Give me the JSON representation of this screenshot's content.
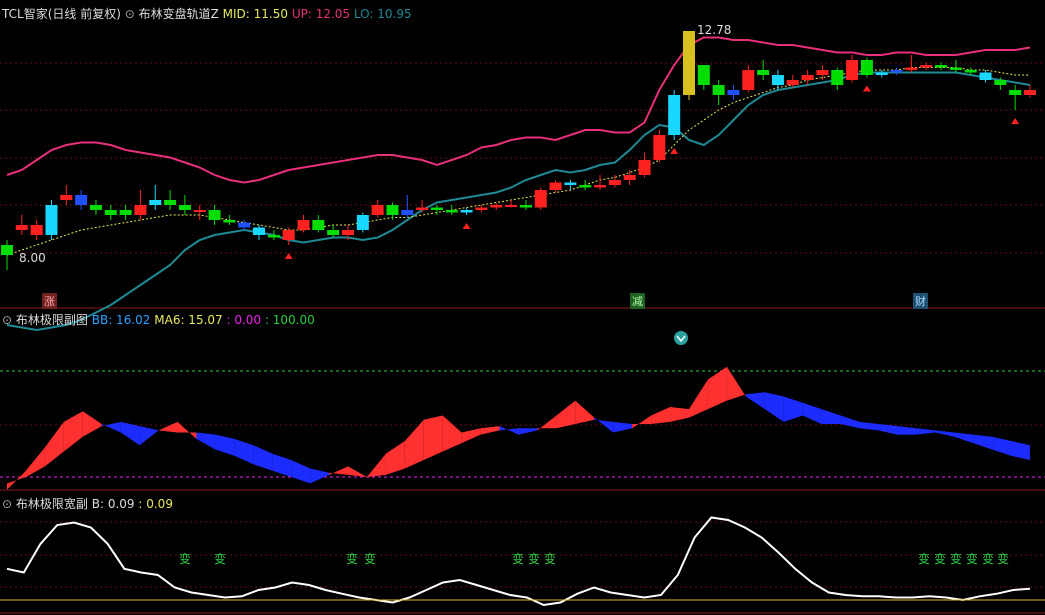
{
  "header_main": {
    "stock": "TCL智家(日线 前复权)",
    "indicator": "布林变盘轨道Z",
    "mid_label": "MID: 11.50",
    "up_label": "UP: 12.05",
    "lo_label": "LO: 10.95"
  },
  "header_sub1": {
    "indicator": "布林极限副图",
    "bb_label": "BB: 16.02",
    "ma6_label": "MA6: 15.07",
    "v1_label": ": 0.00",
    "v2_label": ": 100.00"
  },
  "header_sub2": {
    "indicator": "布林极限宽副",
    "b_label": "B: 0.09",
    "v_label": ": 0.09"
  },
  "price_labels": {
    "high": "12.78",
    "low": "8.00"
  },
  "event_labels": {
    "zhang": "涨",
    "jian": "减",
    "cai": "财"
  },
  "bian_label": "变",
  "colors": {
    "up_band": "#e8307a",
    "lo_band": "#1e8a96",
    "mid": "#e8e85a",
    "bull": "#ff2020",
    "bear": "#00dd00",
    "blue": "#2050ff",
    "cyan": "#1ad7ff",
    "yellow": "#d8c020",
    "magenta": "#ee22ee",
    "white": "#ffffff"
  },
  "chart_data": [
    {
      "type": "candlestick",
      "title": "布林变盘轨道Z",
      "annotations": [
        "12.78",
        "8.00"
      ],
      "candles": [
        [
          8.5,
          8.3,
          8.6,
          8.0
        ],
        [
          8.8,
          8.9,
          9.1,
          8.7
        ],
        [
          8.7,
          8.9,
          9.0,
          8.6
        ],
        [
          8.7,
          9.3,
          9.4,
          8.6
        ],
        [
          9.4,
          9.5,
          9.7,
          9.3
        ],
        [
          9.5,
          9.3,
          9.6,
          9.2
        ],
        [
          9.3,
          9.2,
          9.4,
          9.1
        ],
        [
          9.2,
          9.1,
          9.3,
          9.0
        ],
        [
          9.2,
          9.1,
          9.3,
          9.0
        ],
        [
          9.1,
          9.3,
          9.6,
          9.0
        ],
        [
          9.3,
          9.4,
          9.7,
          9.2
        ],
        [
          9.4,
          9.3,
          9.6,
          9.2
        ],
        [
          9.3,
          9.2,
          9.5,
          9.1
        ],
        [
          9.2,
          9.2,
          9.3,
          9.0
        ],
        [
          9.2,
          9.0,
          9.3,
          8.9
        ],
        [
          9.0,
          8.95,
          9.1,
          8.9
        ],
        [
          8.95,
          8.85,
          9.0,
          8.8
        ],
        [
          8.85,
          8.7,
          8.9,
          8.6
        ],
        [
          8.7,
          8.65,
          8.8,
          8.6
        ],
        [
          8.6,
          8.8,
          8.85,
          8.5
        ],
        [
          8.8,
          9.0,
          9.1,
          8.75
        ],
        [
          9.0,
          8.8,
          9.1,
          8.75
        ],
        [
          8.8,
          8.7,
          8.9,
          8.65
        ],
        [
          8.7,
          8.8,
          8.9,
          8.6
        ],
        [
          8.8,
          9.1,
          9.15,
          8.75
        ],
        [
          9.1,
          9.3,
          9.4,
          9.05
        ],
        [
          9.3,
          9.1,
          9.35,
          9.0
        ],
        [
          9.1,
          9.2,
          9.5,
          9.05
        ],
        [
          9.2,
          9.25,
          9.4,
          9.15
        ],
        [
          9.25,
          9.2,
          9.3,
          9.1
        ],
        [
          9.2,
          9.15,
          9.3,
          9.1
        ],
        [
          9.15,
          9.2,
          9.25,
          9.1
        ],
        [
          9.2,
          9.25,
          9.3,
          9.15
        ],
        [
          9.25,
          9.3,
          9.35,
          9.2
        ],
        [
          9.3,
          9.3,
          9.4,
          9.25
        ],
        [
          9.3,
          9.25,
          9.4,
          9.2
        ],
        [
          9.25,
          9.6,
          9.65,
          9.2
        ],
        [
          9.6,
          9.75,
          9.8,
          9.55
        ],
        [
          9.75,
          9.7,
          9.8,
          9.6
        ],
        [
          9.7,
          9.65,
          9.8,
          9.6
        ],
        [
          9.65,
          9.7,
          9.9,
          9.6
        ],
        [
          9.7,
          9.8,
          9.9,
          9.65
        ],
        [
          9.8,
          9.9,
          10.0,
          9.7
        ],
        [
          9.9,
          10.2,
          10.35,
          9.85
        ],
        [
          10.2,
          10.7,
          10.8,
          10.15
        ],
        [
          10.7,
          11.5,
          11.6,
          10.6
        ],
        [
          11.5,
          12.78,
          12.78,
          11.4
        ],
        [
          12.1,
          11.7,
          12.1,
          11.6
        ],
        [
          11.7,
          11.5,
          11.8,
          11.3
        ],
        [
          11.5,
          11.6,
          11.7,
          11.4
        ],
        [
          11.6,
          12.0,
          12.1,
          11.55
        ],
        [
          12.0,
          11.9,
          12.2,
          11.8
        ],
        [
          11.9,
          11.7,
          12.0,
          11.6
        ],
        [
          11.7,
          11.8,
          11.9,
          11.65
        ],
        [
          11.8,
          11.9,
          12.0,
          11.7
        ],
        [
          11.9,
          12.0,
          12.1,
          11.8
        ],
        [
          12.0,
          11.7,
          12.05,
          11.6
        ],
        [
          11.8,
          12.2,
          12.3,
          11.75
        ],
        [
          12.2,
          11.9,
          12.25,
          11.85
        ],
        [
          11.9,
          11.95,
          12.0,
          11.85
        ],
        [
          11.95,
          12.0,
          12.05,
          11.9
        ],
        [
          12.0,
          12.05,
          12.3,
          11.95
        ],
        [
          12.05,
          12.1,
          12.15,
          12.0
        ],
        [
          12.1,
          12.05,
          12.15,
          12.0
        ],
        [
          12.05,
          12.0,
          12.2,
          11.95
        ],
        [
          12.0,
          11.95,
          12.05,
          11.9
        ],
        [
          11.95,
          11.8,
          12.0,
          11.75
        ],
        [
          11.8,
          11.7,
          11.85,
          11.6
        ],
        [
          11.6,
          11.5,
          11.7,
          11.2
        ],
        [
          11.5,
          11.6,
          11.7,
          11.45
        ]
      ],
      "up_band": [
        9.9,
        10.0,
        10.2,
        10.4,
        10.5,
        10.55,
        10.55,
        10.5,
        10.4,
        10.35,
        10.3,
        10.25,
        10.15,
        10.05,
        9.9,
        9.8,
        9.75,
        9.8,
        9.9,
        10.0,
        10.05,
        10.1,
        10.15,
        10.2,
        10.25,
        10.3,
        10.3,
        10.25,
        10.2,
        10.1,
        10.2,
        10.3,
        10.45,
        10.5,
        10.6,
        10.65,
        10.65,
        10.6,
        10.7,
        10.8,
        10.8,
        10.75,
        10.75,
        10.95,
        11.6,
        12.1,
        12.5,
        12.65,
        12.65,
        12.6,
        12.6,
        12.55,
        12.5,
        12.5,
        12.45,
        12.4,
        12.35,
        12.35,
        12.3,
        12.3,
        12.35,
        12.35,
        12.3,
        12.3,
        12.3,
        12.35,
        12.4,
        12.4,
        12.4,
        12.45
      ],
      "mid_band": [
        8.3,
        8.4,
        8.5,
        8.6,
        8.7,
        8.8,
        8.85,
        8.9,
        8.95,
        9.0,
        9.05,
        9.1,
        9.1,
        9.1,
        9.05,
        9.0,
        8.95,
        8.9,
        8.85,
        8.8,
        8.8,
        8.85,
        8.9,
        8.9,
        8.95,
        9.0,
        9.05,
        9.05,
        9.1,
        9.15,
        9.2,
        9.25,
        9.3,
        9.35,
        9.4,
        9.45,
        9.5,
        9.55,
        9.6,
        9.7,
        9.8,
        9.85,
        9.95,
        10.05,
        10.2,
        10.5,
        10.8,
        11.0,
        11.2,
        11.35,
        11.45,
        11.55,
        11.65,
        11.7,
        11.8,
        11.85,
        11.9,
        11.95,
        12.0,
        12.0,
        12.0,
        12.05,
        12.05,
        12.05,
        12.05,
        12.0,
        12.0,
        11.95,
        11.9,
        11.9
      ],
      "lo_band": [
        6.9,
        6.85,
        6.8,
        6.85,
        6.9,
        7.0,
        7.15,
        7.3,
        7.5,
        7.7,
        7.9,
        8.1,
        8.4,
        8.6,
        8.7,
        8.75,
        8.8,
        8.75,
        8.7,
        8.6,
        8.55,
        8.6,
        8.65,
        8.65,
        8.6,
        8.65,
        8.8,
        9.0,
        9.2,
        9.35,
        9.4,
        9.45,
        9.5,
        9.55,
        9.65,
        9.8,
        9.9,
        10.0,
        9.95,
        10.0,
        10.1,
        10.15,
        10.4,
        10.7,
        10.9,
        10.85,
        10.6,
        10.5,
        10.7,
        11.0,
        11.3,
        11.5,
        11.6,
        11.65,
        11.7,
        11.75,
        11.8,
        11.9,
        11.95,
        11.95,
        11.95,
        11.95,
        11.95,
        11.95,
        11.95,
        11.9,
        11.85,
        11.8,
        11.75,
        11.7
      ]
    },
    {
      "type": "area",
      "title": "布林极限副图",
      "series": [
        {
          "name": "BB",
          "values": [
            -12,
            6,
            28,
            52,
            62,
            50,
            42,
            30,
            44,
            52,
            36,
            26,
            20,
            12,
            6,
            0,
            -6,
            2,
            10,
            0,
            22,
            34,
            54,
            58,
            42,
            46,
            48,
            40,
            44,
            58,
            72,
            56,
            42,
            46,
            58,
            66,
            64,
            92,
            104,
            76,
            64,
            52,
            58,
            50,
            50,
            46,
            44,
            40,
            40,
            42,
            38,
            32,
            26,
            20,
            16
          ]
        },
        {
          "name": "MA6",
          "values": [
            -6,
            0,
            10,
            24,
            38,
            48,
            52,
            48,
            44,
            42,
            42,
            40,
            36,
            30,
            22,
            16,
            8,
            4,
            2,
            0,
            2,
            8,
            16,
            24,
            32,
            40,
            44,
            46,
            46,
            46,
            50,
            54,
            52,
            50,
            50,
            52,
            56,
            64,
            72,
            78,
            80,
            76,
            70,
            64,
            58,
            52,
            50,
            48,
            46,
            44,
            42,
            40,
            38,
            34,
            30
          ]
        }
      ],
      "reference_lines": [
        100,
        0
      ]
    },
    {
      "type": "line",
      "title": "布林极限宽副",
      "series": [
        {
          "name": "B",
          "values": [
            0.25,
            0.22,
            0.45,
            0.6,
            0.62,
            0.58,
            0.45,
            0.25,
            0.22,
            0.2,
            0.1,
            0.06,
            0.04,
            0.02,
            0.03,
            0.08,
            0.1,
            0.14,
            0.12,
            0.08,
            0.05,
            0.02,
            0.0,
            -0.02,
            0.02,
            0.08,
            0.14,
            0.16,
            0.12,
            0.08,
            0.04,
            0.02,
            -0.04,
            -0.02,
            0.05,
            0.1,
            0.06,
            0.04,
            0.02,
            0.04,
            0.2,
            0.5,
            0.66,
            0.64,
            0.58,
            0.5,
            0.38,
            0.25,
            0.14,
            0.06,
            0.04,
            0.03,
            0.03,
            0.02,
            0.02,
            0.03,
            0.02,
            0.0,
            0.03,
            0.05,
            0.08,
            0.09
          ]
        }
      ],
      "markers": "变"
    }
  ]
}
